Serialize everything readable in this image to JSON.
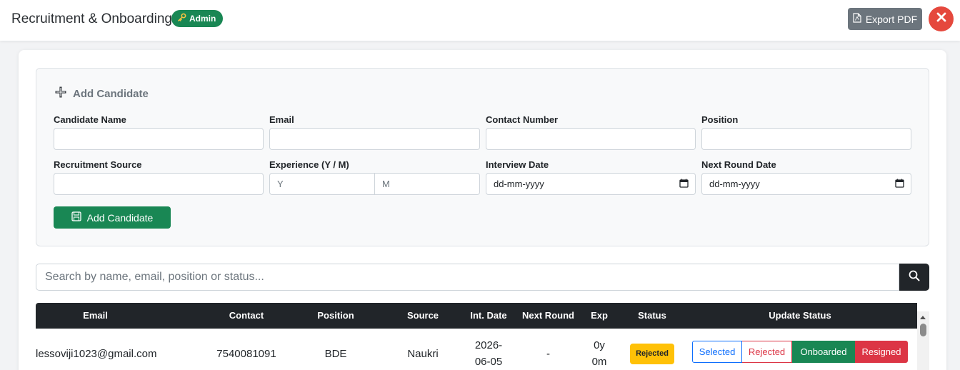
{
  "header": {
    "title": "Recruitment & Onboarding",
    "role_badge": "Admin",
    "export_label": "Export PDF"
  },
  "form": {
    "title": "Add Candidate",
    "fields": {
      "candidate_name": {
        "label": "Candidate Name",
        "value": ""
      },
      "email": {
        "label": "Email",
        "value": ""
      },
      "contact_number": {
        "label": "Contact Number",
        "value": ""
      },
      "position": {
        "label": "Position",
        "value": ""
      },
      "recruitment_source": {
        "label": "Recruitment Source",
        "value": ""
      },
      "experience": {
        "label": "Experience (Y / M)",
        "years_placeholder": "Y",
        "months_placeholder": "M"
      },
      "interview_date": {
        "label": "Interview Date",
        "placeholder": "dd-mm-yyyy"
      },
      "next_round_date": {
        "label": "Next Round Date",
        "placeholder": "dd-mm-yyyy"
      }
    },
    "submit_label": "Add Candidate"
  },
  "search": {
    "placeholder": "Search by name, email, position or status..."
  },
  "table": {
    "columns": [
      "Email",
      "Contact",
      "Position",
      "Source",
      "Int. Date",
      "Next Round",
      "Exp",
      "Status",
      "Update Status"
    ],
    "rows": [
      {
        "email": "lessoviji1023@gmail.com",
        "contact": "7540081091",
        "position": "BDE",
        "source": "Naukri",
        "int_date_line1": "2026-",
        "int_date_line2": "06-05",
        "next_round": "-",
        "exp_line1": "0y",
        "exp_line2": "0m",
        "status": "Rejected",
        "actions": [
          "Selected",
          "Rejected",
          "Onboarded",
          "Resigned"
        ]
      }
    ]
  },
  "colors": {
    "success": "#198754",
    "danger": "#dc3545",
    "primary": "#0d6efd",
    "warning": "#ffc107",
    "dark": "#212529",
    "secondary": "#6c757d"
  }
}
